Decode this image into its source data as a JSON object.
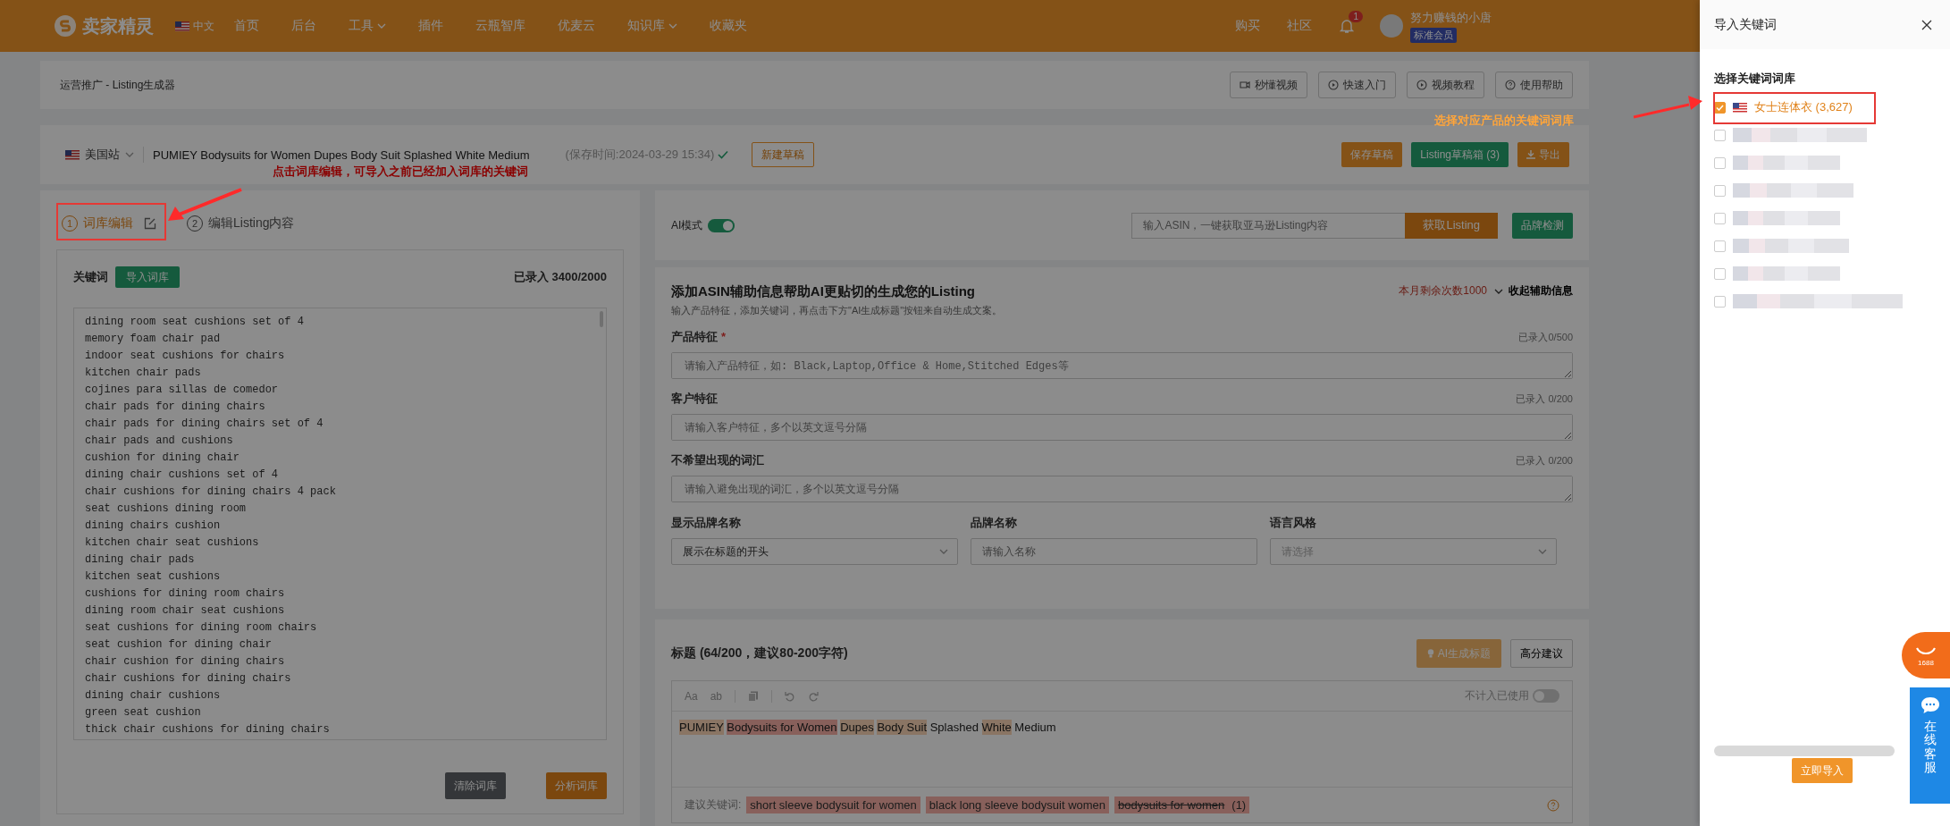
{
  "nav": {
    "logo": "卖家精灵",
    "language": "中文",
    "items": [
      {
        "label": "首页",
        "dropdown": false
      },
      {
        "label": "后台",
        "dropdown": false
      },
      {
        "label": "工具",
        "dropdown": true
      },
      {
        "label": "插件",
        "dropdown": false
      },
      {
        "label": "云瓶智库",
        "dropdown": false
      },
      {
        "label": "优麦云",
        "dropdown": false
      },
      {
        "label": "知识库",
        "dropdown": true
      },
      {
        "label": "收藏夹",
        "dropdown": false
      }
    ],
    "right_links": [
      "购买",
      "社区"
    ],
    "notification_count": "1",
    "user_name": "努力赚钱的小唐",
    "user_badge": "标准会员"
  },
  "breadcrumb": "运营推广 - Listing生成器",
  "help_buttons": [
    {
      "label": "秒懂视频",
      "kind": "video"
    },
    {
      "label": "快速入门",
      "kind": "play"
    },
    {
      "label": "视频教程",
      "kind": "play"
    },
    {
      "label": "使用帮助",
      "kind": "help"
    }
  ],
  "listing": {
    "marketplace": "美国站",
    "title": "PUMIEY Bodysuits for Women Dupes Body Suit Splashed White Medium",
    "saved_time": "(保存时间:2024-03-29 15:34)",
    "saved": true,
    "new_draft": "新建草稿",
    "actions": [
      {
        "label": "保存草稿",
        "kind": "save"
      },
      {
        "label": "Listing草稿箱 (3)",
        "kind": "drafts"
      },
      {
        "label": "导出",
        "kind": "export"
      }
    ]
  },
  "steps": [
    {
      "number": "1",
      "label": "词库编辑",
      "selected": true
    },
    {
      "number": "2",
      "label": "编辑Listing内容",
      "selected": false
    }
  ],
  "keywords": {
    "label": "关键词",
    "import_button": "导入词库",
    "count": "已录入 3400/2000",
    "lines": [
      "dining room seat cushions set of 4",
      "memory foam chair pad",
      "indoor seat cushions for chairs",
      "kitchen chair pads",
      "cojines para sillas de comedor",
      "chair pads for dining chairs",
      "chair pads for dining chairs set of 4",
      "chair pads and cushions",
      "cushion for dining chair",
      "dining chair cushions set of 4",
      "chair cushions for dining chairs 4 pack",
      "seat cushions dining room",
      "dining chairs cushion",
      "kitchen chair seat cushions",
      "dining chair pads",
      "kitchen seat cushions",
      "cushions for dining room chairs",
      "dining room chair seat cushions",
      "seat cushions for dining room chairs",
      "seat cushion for dining chair",
      "chair cushion for dining chairs",
      "chair cushions for dining chairs",
      "dining chair cushions",
      "green seat cushion",
      "thick chair cushions for dining chairs"
    ],
    "clear_button": "清除词库",
    "analyze_button": "分析词库"
  },
  "ai_mode": {
    "label": "AI模式",
    "on": true,
    "asin_placeholder": "输入ASIN，一键获取亚马逊Listing内容",
    "fetch_button": "获取Listing",
    "brand_check_button": "品牌检测"
  },
  "assist": {
    "title": "添加ASIN辅助信息帮助AI更贴切的生成您的Listing",
    "subtitle": "输入产品特征，添加关键词，再点击下方\"AI生成标题\"按钮来自动生成文案。",
    "remaining": "本月剩余次数1000",
    "collapse": "收起辅助信息",
    "fields": [
      {
        "label": "产品特征",
        "required_mark": "*",
        "count": "已录入0/500",
        "placeholder": "请输入产品特征，如: Black,Laptop,Office & Home,Stitched Edges等"
      },
      {
        "label": "客户特征",
        "count": "已录入 0/200",
        "placeholder": "请输入客户特征，多个以英文逗号分隔"
      },
      {
        "label": "不希望出现的词汇",
        "count": "已录入 0/200",
        "placeholder": "请输入避免出现的词汇，多个以英文逗号分隔"
      }
    ],
    "options": [
      {
        "label": "显示品牌名称",
        "kind": "select",
        "value": "展示在标题的开头"
      },
      {
        "label": "品牌名称",
        "kind": "input",
        "placeholder": "请输入名称"
      },
      {
        "label": "语言风格",
        "kind": "select",
        "placeholder": "请选择"
      }
    ]
  },
  "title_section": {
    "heading": "标题 (64/200，建议80-200字符)",
    "ai_button": "AI生成标题",
    "score_button": "高分建议",
    "tools": [
      "Aa",
      "ab"
    ],
    "exclude_used": {
      "label": "不计入已使用",
      "on": false
    },
    "segments": [
      {
        "text": "PUMIEY",
        "kind": "partial"
      },
      {
        "text": "Bodysuits for Women",
        "kind": "full"
      },
      {
        "text": "Dupes",
        "kind": "partial"
      },
      {
        "text": "Body Suit",
        "kind": "partial"
      },
      {
        "text": "Splashed",
        "kind": "plain"
      },
      {
        "text": "White",
        "kind": "partial"
      },
      {
        "text": "Medium",
        "kind": "plain"
      }
    ],
    "suggest_label": "建议关键词:",
    "suggestions": [
      {
        "text": "short sleeve bodysuit for women",
        "used": false
      },
      {
        "text": "black long sleeve bodysuit women",
        "used": false
      },
      {
        "text": "bodysuits for women",
        "used": true,
        "count": "(1)"
      }
    ]
  },
  "drawer": {
    "title": "导入关键词",
    "section": "选择关键词词库",
    "libraries": [
      {
        "kind": "library",
        "label": "女士连体衣 (3,627)",
        "checked": true
      },
      {
        "kind": "redacted",
        "checked": false
      },
      {
        "kind": "redacted",
        "checked": false
      },
      {
        "kind": "redacted",
        "checked": false
      },
      {
        "kind": "redacted",
        "checked": false
      },
      {
        "kind": "redacted",
        "checked": false
      },
      {
        "kind": "redacted",
        "checked": false
      },
      {
        "kind": "redacted",
        "checked": false
      }
    ],
    "import_button": "立即导入"
  },
  "widgets": {
    "badge": "1688",
    "support": "在线客服"
  },
  "annotations": [
    {
      "kind": "note",
      "text": "点击词库编辑，可导入之前已经加入词库的关键词"
    },
    {
      "kind": "hint",
      "text": "选择对应产品的关键词词库"
    }
  ]
}
